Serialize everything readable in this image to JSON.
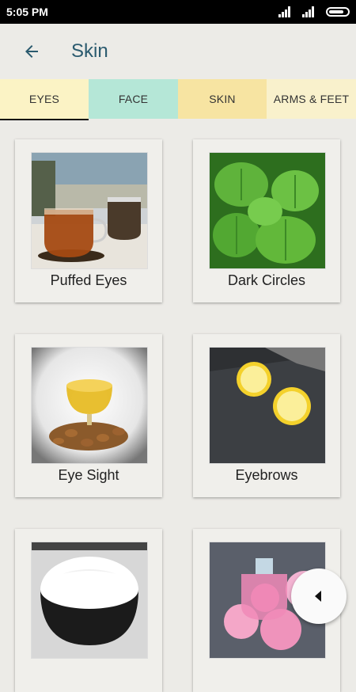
{
  "status_bar": {
    "time": "5:05 PM",
    "icons": [
      "signal-icon",
      "signal-icon",
      "battery-icon"
    ]
  },
  "app_bar": {
    "title": "Skin",
    "back_icon": "arrow-left-icon"
  },
  "tabs": [
    {
      "label": "EYES",
      "selected": true,
      "color": "#fbf3c5"
    },
    {
      "label": "FACE",
      "selected": false,
      "color": "#b5e7d7"
    },
    {
      "label": "SKIN",
      "selected": false,
      "color": "#f7e4a2"
    },
    {
      "label": "ARMS & FEET",
      "selected": false,
      "color": "#f9f1cc"
    }
  ],
  "cards": [
    {
      "label": "Puffed Eyes",
      "image": "tea-cup-photo"
    },
    {
      "label": "Dark Circles",
      "image": "mint-leaves-photo"
    },
    {
      "label": "Eye Sight",
      "image": "almond-oil-photo"
    },
    {
      "label": "Eyebrows",
      "image": "lemon-slices-photo"
    },
    {
      "label": "",
      "image": "cream-jar-photo"
    },
    {
      "label": "",
      "image": "rose-water-photo"
    }
  ],
  "fab": {
    "icon": "play-left-icon"
  }
}
